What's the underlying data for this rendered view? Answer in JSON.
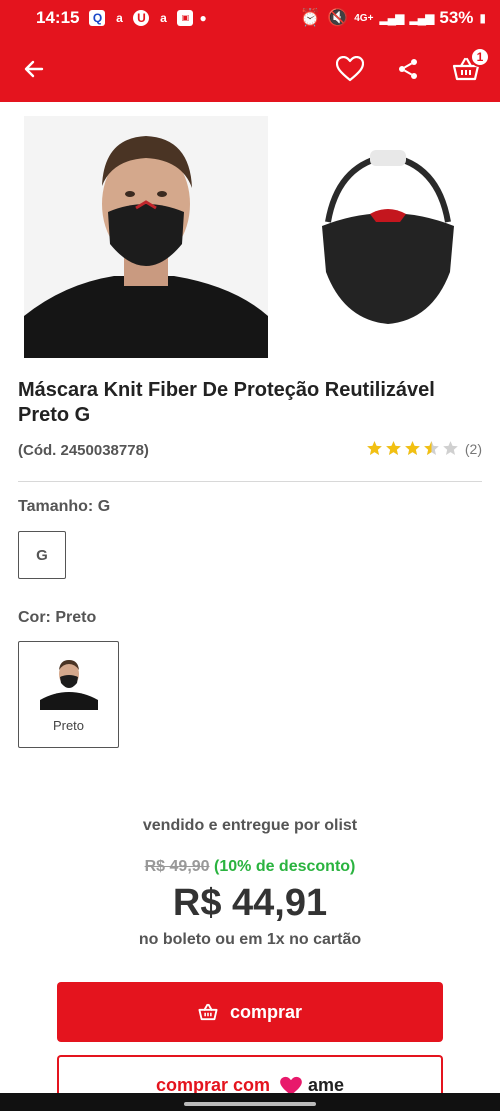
{
  "status_bar": {
    "time": "14:15",
    "battery": "53%",
    "network": "4G+"
  },
  "app_bar": {
    "back_icon": "arrow-left-icon",
    "favorite_icon": "heart-outline-icon",
    "share_icon": "share-icon",
    "cart_icon": "basket-icon",
    "cart_count": "1"
  },
  "product": {
    "title": "Máscara Knit Fiber De Proteção Reutilizável Preto G",
    "code": "(Cód. 2450038778)",
    "rating": 3.5,
    "rating_max": 5,
    "review_count": "(2)"
  },
  "variants": {
    "size_label": "Tamanho: G",
    "size_option": "G",
    "color_label": "Cor: Preto",
    "color_option": "Preto"
  },
  "pricing": {
    "seller": "vendido e entregue por olist",
    "old_price": "R$ 49,90",
    "discount": "(10% de desconto)",
    "price": "R$ 44,91",
    "payment_note": "no boleto ou em 1x no cartão"
  },
  "actions": {
    "buy_label": "comprar",
    "ame_label": "comprar com",
    "ame_brand": "ame"
  },
  "colors": {
    "brand_red": "#e4141e",
    "discount_green": "#2ab33f",
    "star_gold": "#f2c012"
  }
}
